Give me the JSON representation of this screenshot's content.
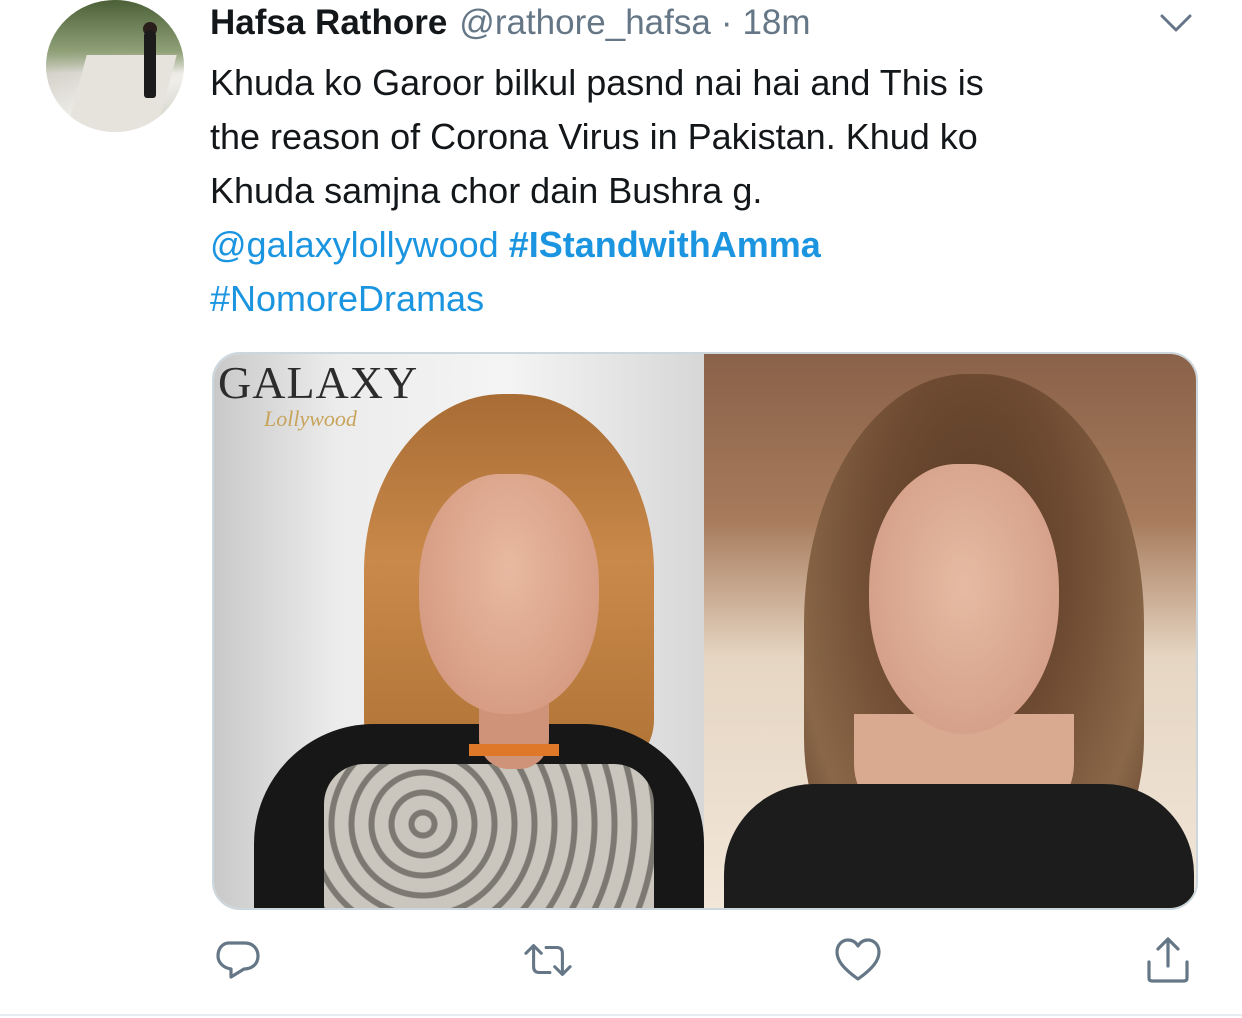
{
  "tweet": {
    "author_name": "Hafsa Rathore",
    "author_handle": "@rathore_hafsa",
    "separator": "·",
    "time": "18m",
    "text_lines": [
      "Khuda ko Garoor bilkul pasnd nai hai and This is",
      "the reason of Corona Virus in Pakistan. Khud ko",
      "Khuda samjna chor dain Bushra g."
    ],
    "mention": "@galaxylollywood",
    "hashtag_1": "#IStandwithAmma",
    "hashtag_2": "#NomoreDramas"
  },
  "media": {
    "logo_main": "GALAXY",
    "logo_sub": "Lollywood"
  },
  "actions": {
    "icons": [
      "reply-icon",
      "retweet-icon",
      "like-icon",
      "share-icon"
    ]
  },
  "colors": {
    "link": "#1b95e0",
    "secondary_text": "#657786",
    "primary_text": "#14171a",
    "icon": "#657786"
  }
}
